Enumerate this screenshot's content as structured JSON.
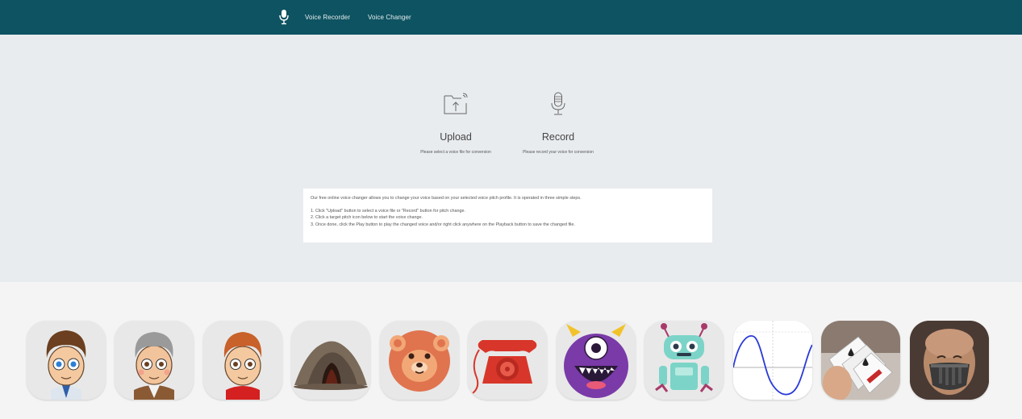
{
  "nav": {
    "logo_icon": "microphone-icon",
    "links": [
      "Voice Recorder",
      "Voice Changer"
    ]
  },
  "actions": [
    {
      "title": "Upload",
      "subtitle": "Please select a voice file for conversion",
      "icon": "upload-folder-icon"
    },
    {
      "title": "Record",
      "subtitle": "Please record your voice for conversion",
      "icon": "microphone-icon"
    }
  ],
  "info": {
    "intro": "Our free online voice changer allows you to change your voice based on your selected voice pitch profile. It is operated in three simple steps.",
    "steps": [
      "1. Click \"Upload\" button to select a voice file or \"Record\" button for pitch change.",
      "2. Click a target pitch icon below to start the voice change.",
      "3. Once done, click the Play button to play the changed voice and/or right click anywhere on the Playback button to save the changed file."
    ]
  },
  "voices": [
    {
      "id": "boy",
      "icon": "boy-avatar-icon"
    },
    {
      "id": "old-man",
      "icon": "old-man-avatar-icon"
    },
    {
      "id": "kid",
      "icon": "kid-avatar-icon"
    },
    {
      "id": "cave",
      "icon": "cave-icon"
    },
    {
      "id": "bear",
      "icon": "bear-icon"
    },
    {
      "id": "telephone",
      "icon": "telephone-icon"
    },
    {
      "id": "monster",
      "icon": "monster-icon"
    },
    {
      "id": "robot",
      "icon": "robot-icon"
    },
    {
      "id": "sine-wave",
      "icon": "sine-wave-icon"
    },
    {
      "id": "cards",
      "icon": "playing-cards-icon"
    },
    {
      "id": "masked-man",
      "icon": "masked-man-icon"
    }
  ],
  "colors": {
    "header": "#0e5361",
    "hero_bg": "#e9ecef",
    "page_bg": "#f4f4f4"
  }
}
